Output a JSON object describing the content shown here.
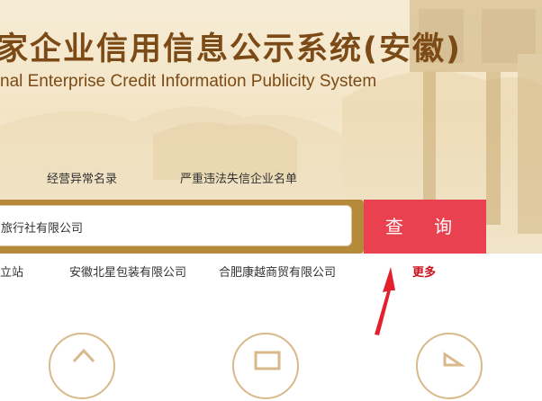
{
  "header": {
    "title": "家企业信用信息公示系统(安徽)",
    "subtitle": "nal Enterprise Credit Information Publicity System"
  },
  "nav": {
    "abnormal_list": "经营异常名录",
    "serious_list": "严重违法失信企业名单"
  },
  "search": {
    "value": "旅行社有限公司",
    "button_label": "查 询"
  },
  "hot_searches": [
    "立站",
    "安徽北星包装有限公司",
    "合肥康越商贸有限公司"
  ],
  "more_label": "更多",
  "colors": {
    "brand_brown": "#7c4a16",
    "search_red": "#e9414f",
    "link_red": "#c8101e",
    "annotation_arrow": "#e3212c"
  },
  "icons": [
    "mountain-decoration-icon",
    "bronze-ding-decoration-icon",
    "annotation-arrow-icon",
    "service-circle-icon"
  ]
}
